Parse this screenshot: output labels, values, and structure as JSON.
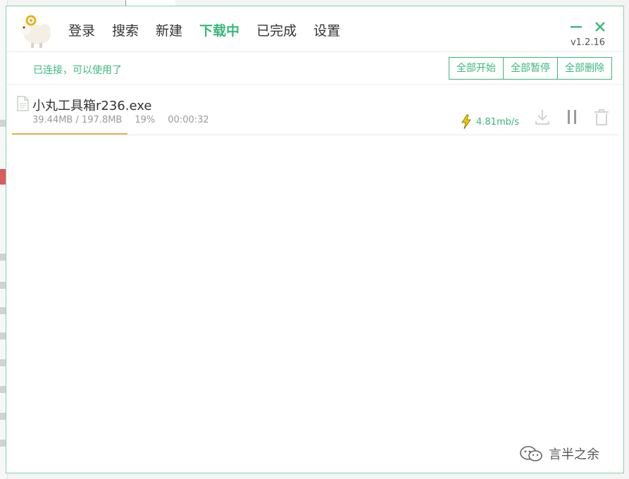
{
  "app": {
    "version": "v1.2.16",
    "nav": [
      {
        "label": "登录",
        "active": false
      },
      {
        "label": "搜索",
        "active": false
      },
      {
        "label": "新建",
        "active": false
      },
      {
        "label": "下载中",
        "active": true
      },
      {
        "label": "已完成",
        "active": false
      },
      {
        "label": "设置",
        "active": false
      }
    ],
    "window_controls": [
      "minimize-icon",
      "close-icon"
    ]
  },
  "toolbar": {
    "status": "已连接，可以使用了",
    "start_all": "全部开始",
    "pause_all": "全部暂停",
    "delete_all": "全部删除"
  },
  "tasks": [
    {
      "name": "小丸工具箱r236.exe",
      "size": "39.44MB / 197.8MB",
      "percent": "19%",
      "progress": 0.19,
      "time": "00:00:32",
      "speed": "4.81mb/s",
      "actions": [
        "download-icon",
        "pause-icon",
        "trash-icon"
      ]
    }
  ],
  "watermark": "言半之余",
  "colors": {
    "accent": "#3bb77e",
    "progress": "#e0b84b",
    "bolt": "#f2c800"
  }
}
